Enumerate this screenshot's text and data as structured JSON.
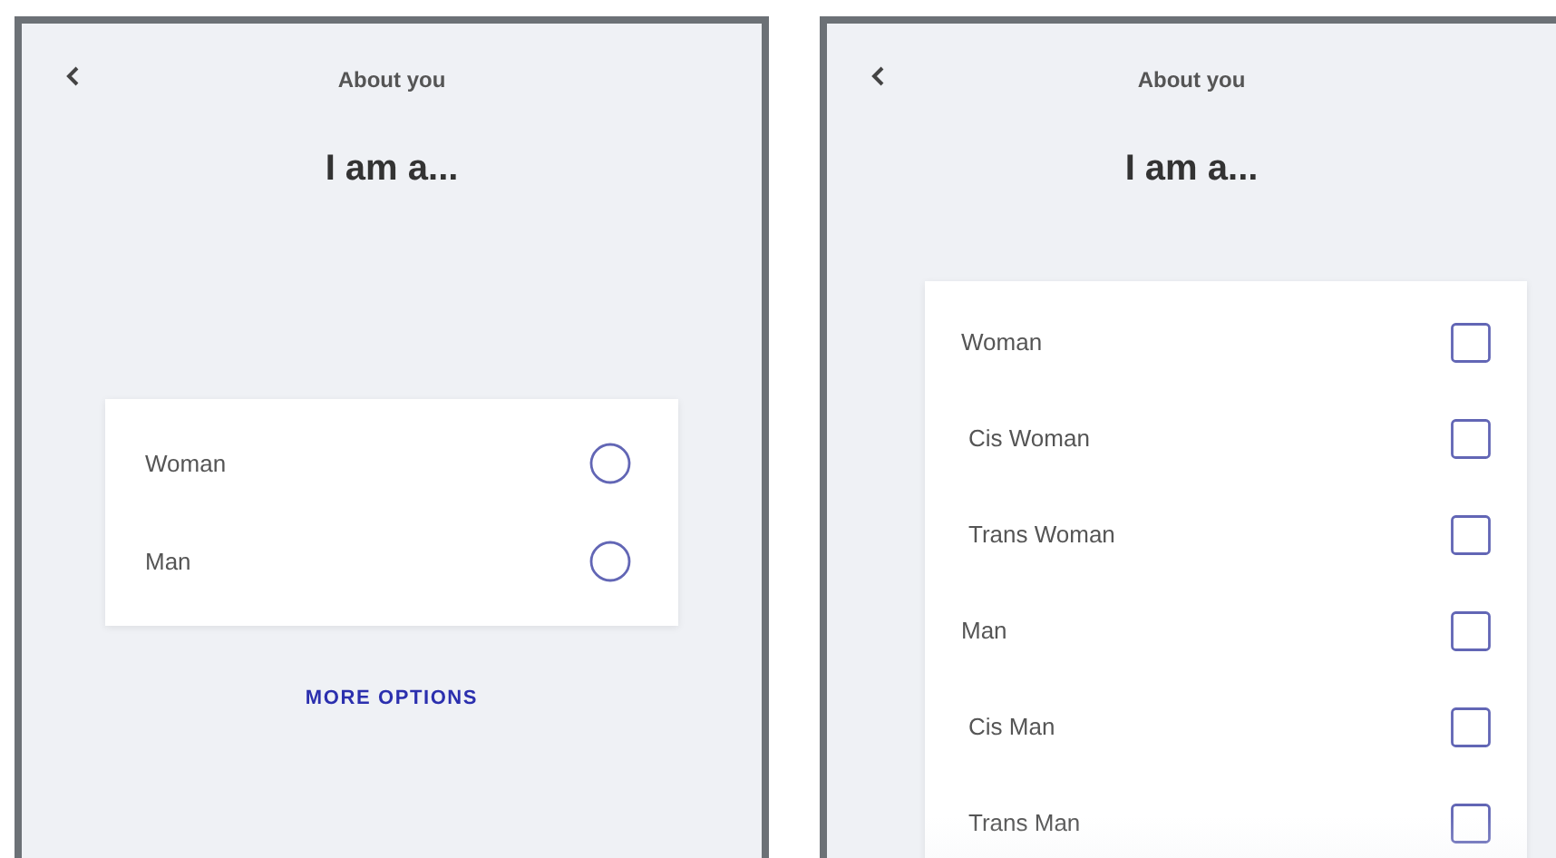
{
  "screens": [
    {
      "header": {
        "title": "About you"
      },
      "heading": "I am a...",
      "options": [
        {
          "kind": "radio",
          "label": "Woman",
          "selected": false
        },
        {
          "kind": "radio",
          "label": "Man",
          "selected": false
        }
      ],
      "more_options": "MORE OPTIONS"
    },
    {
      "header": {
        "title": "About you"
      },
      "heading": "I am a...",
      "options": [
        {
          "kind": "checkbox",
          "label": "Woman",
          "checked": false,
          "children": [
            {
              "kind": "checkbox",
              "label": "Cis Woman",
              "checked": false
            },
            {
              "kind": "checkbox",
              "label": "Trans Woman",
              "checked": false
            }
          ]
        },
        {
          "kind": "checkbox",
          "label": "Man",
          "checked": false,
          "children": [
            {
              "kind": "checkbox",
              "label": "Cis Man",
              "checked": false
            },
            {
              "kind": "checkbox",
              "label": "Trans Man",
              "checked": false
            }
          ]
        }
      ]
    }
  ]
}
